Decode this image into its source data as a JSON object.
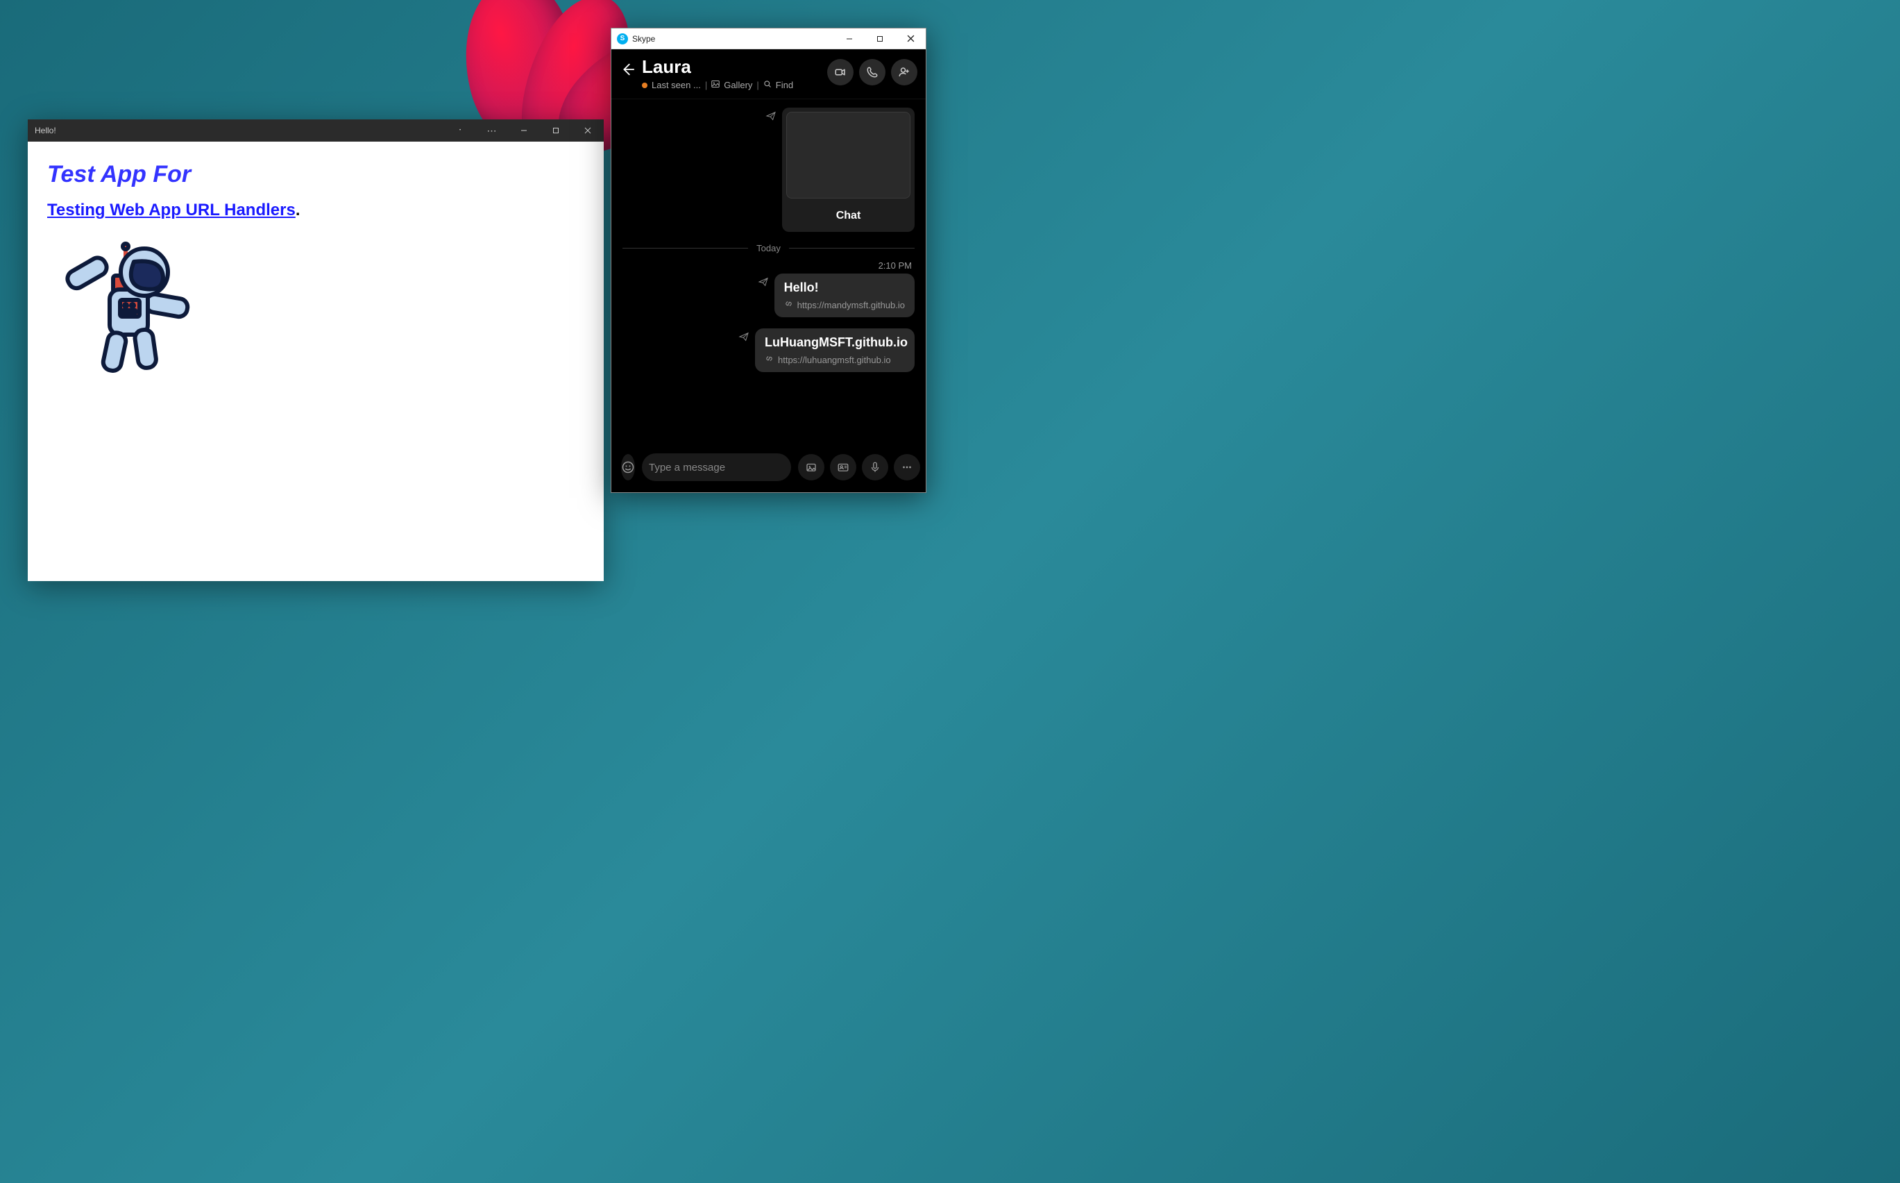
{
  "pwa": {
    "title": "Hello!",
    "heading": "Test App For",
    "subheading_link": "Testing Web App URL Handlers",
    "subheading_suffix": "."
  },
  "skype": {
    "app_name": "Skype",
    "contact_name": "Laura",
    "last_seen": "Last seen ...",
    "gallery_label": "Gallery",
    "find_label": "Find",
    "share_card_button": "Chat",
    "date_divider": "Today",
    "timestamp": "2:10 PM",
    "messages": [
      {
        "title": "Hello!",
        "url": "https://mandymsft.github.io"
      },
      {
        "title": "LuHuangMSFT.github.io",
        "url": "https://luhuangmsft.github.io"
      }
    ],
    "message_placeholder": "Type a message"
  }
}
